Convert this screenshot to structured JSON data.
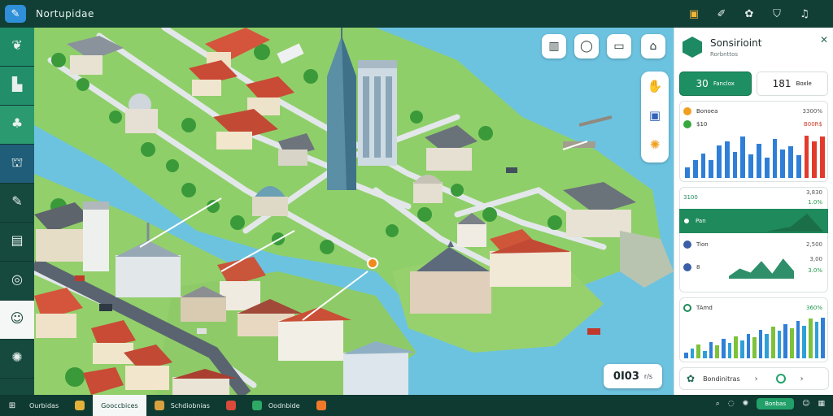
{
  "app": {
    "title": "Nortupidae"
  },
  "topbar": {
    "icons": [
      "badge-icon",
      "pen-icon",
      "gear-icon",
      "shield-icon",
      "bell-icon"
    ]
  },
  "sidebar": {
    "items": [
      {
        "icon": "leaf-icon",
        "label": ""
      },
      {
        "icon": "building-icon",
        "label": ""
      },
      {
        "icon": "plant-icon",
        "label": ""
      },
      {
        "icon": "columns-icon",
        "label": ""
      },
      {
        "icon": "edit-icon",
        "label": ""
      },
      {
        "icon": "chart-icon",
        "label": ""
      },
      {
        "icon": "globe-icon",
        "label": ""
      },
      {
        "icon": "users-icon",
        "label": ""
      },
      {
        "icon": "settings-icon",
        "label": ""
      }
    ]
  },
  "map": {
    "coordinate_value": "0I03",
    "coordinate_unit": "r/s"
  },
  "panel": {
    "title": "Sonsirioint",
    "subtitle": "Rorbnttos",
    "stats": [
      {
        "value": "30",
        "label": "Fanclox"
      },
      {
        "value": "181",
        "label": "Boxle"
      }
    ],
    "chart1_rows": [
      {
        "name": "Bonoea",
        "value": "3300%",
        "color": "#f0a020"
      },
      {
        "name": "$10",
        "value": "B00R$",
        "color": "#37a83f"
      }
    ],
    "list_rows": [
      {
        "name": "3100",
        "value": "3,830",
        "sub": "1.0%"
      },
      {
        "name": "Pan",
        "value": "",
        "sub": ""
      },
      {
        "name": "Tion",
        "value": "2,500",
        "sub": ""
      },
      {
        "name": "8",
        "value": "3,00",
        "sub": "3.0%"
      },
      {
        "name": "TAmd",
        "value": "360%",
        "sub": ""
      }
    ],
    "footer_label": "Bondinitras"
  },
  "taskbar": {
    "items": [
      {
        "label": "Ourbidas"
      },
      {
        "label": "Gooccbices"
      },
      {
        "label": "Schdiobnias"
      },
      {
        "label": ""
      },
      {
        "label": "Oodnbide"
      },
      {
        "label": ""
      }
    ],
    "tray_button": "Bonbas"
  },
  "chart_data": [
    {
      "type": "bar",
      "title": "",
      "categories": [
        "1",
        "2",
        "3",
        "4",
        "5",
        "6",
        "7",
        "8",
        "9",
        "10",
        "11",
        "12",
        "13",
        "14",
        "15",
        "16",
        "17",
        "18"
      ],
      "values": [
        18,
        30,
        42,
        30,
        55,
        62,
        44,
        70,
        40,
        58,
        35,
        66,
        48,
        54,
        38,
        72,
        62,
        70
      ],
      "colors": [
        "#2f7fd8",
        "#2f7fd8",
        "#2f7fd8",
        "#2f7fd8",
        "#2f7fd8",
        "#2f7fd8",
        "#2f7fd8",
        "#2f7fd8",
        "#2f7fd8",
        "#2f7fd8",
        "#2f7fd8",
        "#2f7fd8",
        "#2f7fd8",
        "#2f7fd8",
        "#2f7fd8",
        "#e23b2c",
        "#e23b2c",
        "#e23b2c"
      ]
    },
    {
      "type": "area",
      "title": "",
      "x": [
        0,
        1,
        2,
        3,
        4,
        5,
        6
      ],
      "values": [
        5,
        20,
        12,
        35,
        10,
        40,
        15
      ]
    },
    {
      "type": "bar",
      "title": "",
      "categories": [
        "1",
        "2",
        "3",
        "4",
        "5",
        "6",
        "7",
        "8",
        "9",
        "10",
        "11",
        "12",
        "13",
        "14",
        "15",
        "16",
        "17",
        "18",
        "19",
        "20",
        "21",
        "22",
        "23"
      ],
      "values": [
        10,
        18,
        25,
        14,
        30,
        24,
        35,
        28,
        40,
        32,
        45,
        38,
        52,
        44,
        58,
        50,
        62,
        55,
        68,
        60,
        72,
        66,
        74
      ]
    }
  ]
}
